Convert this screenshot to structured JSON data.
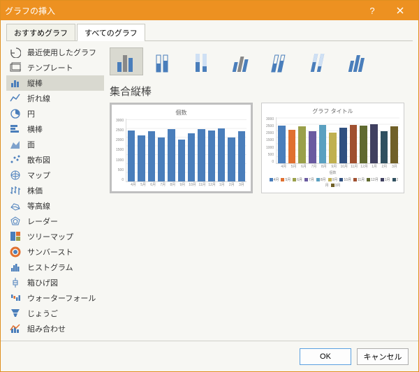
{
  "window": {
    "title": "グラフの挿入"
  },
  "tabs": {
    "recommended": "おすすめグラフ",
    "all": "すべてのグラフ",
    "active": "all"
  },
  "sidebar": {
    "items": [
      {
        "label": "最近使用したグラフ",
        "icon": "recent"
      },
      {
        "label": "テンプレート",
        "icon": "template"
      },
      {
        "label": "縦棒",
        "icon": "column",
        "selected": true
      },
      {
        "label": "折れ線",
        "icon": "line"
      },
      {
        "label": "円",
        "icon": "pie"
      },
      {
        "label": "横棒",
        "icon": "bar"
      },
      {
        "label": "面",
        "icon": "area"
      },
      {
        "label": "散布図",
        "icon": "scatter"
      },
      {
        "label": "マップ",
        "icon": "map"
      },
      {
        "label": "株価",
        "icon": "stock"
      },
      {
        "label": "等高線",
        "icon": "surface"
      },
      {
        "label": "レーダー",
        "icon": "radar"
      },
      {
        "label": "ツリーマップ",
        "icon": "treemap"
      },
      {
        "label": "サンバースト",
        "icon": "sunburst"
      },
      {
        "label": "ヒストグラム",
        "icon": "histogram"
      },
      {
        "label": "箱ひげ図",
        "icon": "boxwhisker"
      },
      {
        "label": "ウォーターフォール",
        "icon": "waterfall"
      },
      {
        "label": "じょうご",
        "icon": "funnel"
      },
      {
        "label": "組み合わせ",
        "icon": "combo"
      }
    ]
  },
  "subtype_selected": 0,
  "chart_name": "集合縦棒",
  "buttons": {
    "ok": "OK",
    "cancel": "キャンセル"
  },
  "chart_data": [
    {
      "type": "bar",
      "title": "個数",
      "categories": [
        "4月",
        "5月",
        "6月",
        "7月",
        "8月",
        "9月",
        "10月",
        "11月",
        "12月",
        "1月",
        "2月",
        "3月"
      ],
      "values": [
        2450,
        2200,
        2400,
        2100,
        2500,
        2000,
        2300,
        2500,
        2450,
        2550,
        2100,
        2400
      ],
      "ylim": [
        0,
        3000
      ],
      "yticks": [
        0,
        500,
        1000,
        1500,
        2000,
        2500,
        3000
      ],
      "series_colors": [
        "#4a7ebb"
      ]
    },
    {
      "type": "bar",
      "title": "グラフ タイトル",
      "xlabel": "個数",
      "categories": [
        "4月",
        "5月",
        "6月",
        "7月",
        "8月",
        "9月",
        "10月",
        "11月",
        "12月",
        "1月",
        "2月",
        "3月"
      ],
      "values": [
        2450,
        2200,
        2400,
        2100,
        2500,
        2000,
        2300,
        2500,
        2450,
        2550,
        2100,
        2400
      ],
      "ylim": [
        0,
        3000
      ],
      "yticks": [
        0,
        500,
        1000,
        1500,
        2000,
        2500,
        3000
      ],
      "series_colors": [
        "#4a7ebb",
        "#e07030",
        "#9aa04a",
        "#6a5aa0",
        "#5aa0c0",
        "#c0b050",
        "#305080",
        "#a05030",
        "#606a30",
        "#404060",
        "#305060",
        "#706028"
      ],
      "legend": [
        "4月",
        "5月",
        "6月",
        "7月",
        "8月",
        "9月",
        "10月",
        "11月",
        "12月",
        "1月",
        "2月",
        "3月"
      ]
    }
  ]
}
